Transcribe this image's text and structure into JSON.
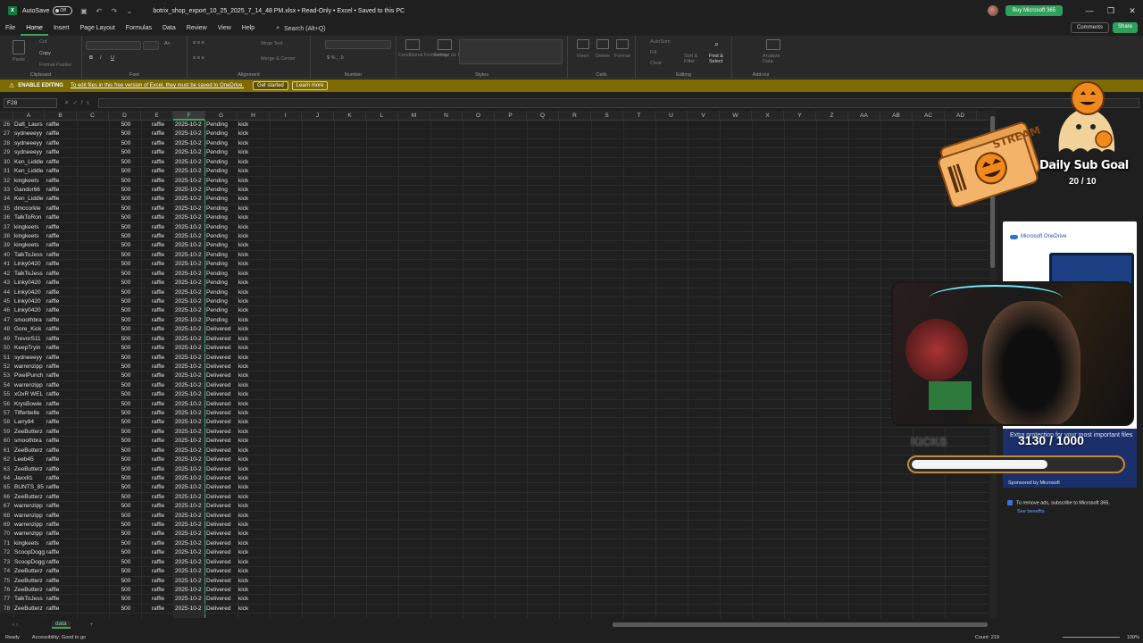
{
  "window": {
    "autosave_label": "AutoSave",
    "autosave_state": "Off",
    "file_title": "botrix_shop_export_10_25_2025_7_14_48 PM.xlsx  •  Read-Only  •  Excel  •  Saved to this PC",
    "buy_label": "Buy Microsoft 365"
  },
  "menu": {
    "tabs": [
      "File",
      "Home",
      "Insert",
      "Page Layout",
      "Formulas",
      "Data",
      "Review",
      "View",
      "Help"
    ],
    "active": "Home",
    "search": "Search (Alt+Q)",
    "comments": "Comments",
    "share": "Share"
  },
  "ribbon": {
    "groups": [
      "Clipboard",
      "Font",
      "Alignment",
      "Number",
      "Styles",
      "Cells",
      "Editing",
      "Add-ins"
    ],
    "paste": "Paste",
    "cut": "Cut",
    "copy": "Copy",
    "format_painter": "Format Painter",
    "wrap_text": "Wrap Text",
    "merge_center": "Merge & Center",
    "conditional": "Conditional Formatting",
    "format_table": "Format as Table",
    "insert": "Insert",
    "delete": "Delete",
    "format": "Format",
    "autosum": "AutoSum",
    "fill": "Fill",
    "clear": "Clear",
    "sort_filter": "Sort & Filter",
    "find_select": "Find & Select",
    "analyze": "Analyze Data"
  },
  "infobar": {
    "title": "ENABLE EDITING",
    "message": "To edit files in this free version of Excel, they must be saved to OneDrive.",
    "get_started": "Get started",
    "learn_more": "Learn more"
  },
  "formula": {
    "namebox": "F28",
    "content": ""
  },
  "grid": {
    "columns": [
      "A",
      "B",
      "C",
      "D",
      "E",
      "F",
      "G",
      "H",
      "I",
      "J",
      "K",
      "L",
      "M",
      "N",
      "O",
      "P",
      "Q",
      "R",
      "S",
      "T",
      "U",
      "V",
      "W",
      "X",
      "Y",
      "Z",
      "AA",
      "AB",
      "AC",
      "AD"
    ],
    "selected_column": "F",
    "rows": [
      [
        26,
        "Daft_Laurs",
        "raffle",
        "500",
        "raffle",
        "2025-10-2",
        "Pending",
        "kick"
      ],
      [
        27,
        "sydneeeyy",
        "raffle",
        "500",
        "raffle",
        "2025-10-2",
        "Pending",
        "kick"
      ],
      [
        28,
        "sydneeeyy",
        "raffle",
        "500",
        "raffle",
        "2025-10-2",
        "Pending",
        "kick"
      ],
      [
        29,
        "sydneeeyy",
        "raffle",
        "500",
        "raffle",
        "2025-10-2",
        "Pending",
        "kick"
      ],
      [
        30,
        "Ken_Liddle",
        "raffle",
        "500",
        "raffle",
        "2025-10-2",
        "Pending",
        "kick"
      ],
      [
        31,
        "Ken_Liddle",
        "raffle",
        "500",
        "raffle",
        "2025-10-2",
        "Pending",
        "kick"
      ],
      [
        32,
        "kingkeets",
        "raffle",
        "500",
        "raffle",
        "2025-10-2",
        "Pending",
        "kick"
      ],
      [
        33,
        "Gandor66",
        "raffle",
        "500",
        "raffle",
        "2025-10-2",
        "Pending",
        "kick"
      ],
      [
        34,
        "Ken_Liddle",
        "raffle",
        "500",
        "raffle",
        "2025-10-2",
        "Pending",
        "kick"
      ],
      [
        35,
        "dmccorkle",
        "raffle",
        "500",
        "raffle",
        "2025-10-2",
        "Pending",
        "kick"
      ],
      [
        36,
        "TalkToRon",
        "raffle",
        "500",
        "raffle",
        "2025-10-2",
        "Pending",
        "kick"
      ],
      [
        37,
        "kingkeets",
        "raffle",
        "500",
        "raffle",
        "2025-10-2",
        "Pending",
        "kick"
      ],
      [
        38,
        "kingkeets",
        "raffle",
        "500",
        "raffle",
        "2025-10-2",
        "Pending",
        "kick"
      ],
      [
        39,
        "kingkeets",
        "raffle",
        "500",
        "raffle",
        "2025-10-2",
        "Pending",
        "kick"
      ],
      [
        40,
        "TalkToJess",
        "raffle",
        "500",
        "raffle",
        "2025-10-2",
        "Pending",
        "kick"
      ],
      [
        41,
        "Linky0420",
        "raffle",
        "500",
        "raffle",
        "2025-10-2",
        "Pending",
        "kick"
      ],
      [
        42,
        "TalkToJess",
        "raffle",
        "500",
        "raffle",
        "2025-10-2",
        "Pending",
        "kick"
      ],
      [
        43,
        "Linky0420",
        "raffle",
        "500",
        "raffle",
        "2025-10-2",
        "Pending",
        "kick"
      ],
      [
        44,
        "Linky0420",
        "raffle",
        "500",
        "raffle",
        "2025-10-2",
        "Pending",
        "kick"
      ],
      [
        45,
        "Linky0420",
        "raffle",
        "500",
        "raffle",
        "2025-10-2",
        "Pending",
        "kick"
      ],
      [
        46,
        "Linky0420",
        "raffle",
        "500",
        "raffle",
        "2025-10-2",
        "Pending",
        "kick"
      ],
      [
        47,
        "smoothbra",
        "raffle",
        "500",
        "raffle",
        "2025-10-2",
        "Pending",
        "kick"
      ],
      [
        48,
        "Gore_Kick",
        "raffle",
        "500",
        "raffle",
        "2025-10-2",
        "Delivered",
        "kick"
      ],
      [
        49,
        "TrevorS11",
        "raffle",
        "500",
        "raffle",
        "2025-10-2",
        "Delivered",
        "kick"
      ],
      [
        50,
        "KeepTryin",
        "raffle",
        "500",
        "raffle",
        "2025-10-2",
        "Delivered",
        "kick"
      ],
      [
        51,
        "sydneeeyy",
        "raffle",
        "500",
        "raffle",
        "2025-10-2",
        "Delivered",
        "kick"
      ],
      [
        52,
        "warrenzipp",
        "raffle",
        "500",
        "raffle",
        "2025-10-2",
        "Delivered",
        "kick"
      ],
      [
        53,
        "PixelPunch",
        "raffle",
        "500",
        "raffle",
        "2025-10-2",
        "Delivered",
        "kick"
      ],
      [
        54,
        "warrenzipp",
        "raffle",
        "500",
        "raffle",
        "2025-10-2",
        "Delivered",
        "kick"
      ],
      [
        55,
        "xOxR WEL",
        "raffle",
        "500",
        "raffle",
        "2025-10-2",
        "Delivered",
        "kick"
      ],
      [
        56,
        "KrysBowie",
        "raffle",
        "500",
        "raffle",
        "2025-10-2",
        "Delivered",
        "kick"
      ],
      [
        57,
        "Tifferbelle",
        "raffle",
        "500",
        "raffle",
        "2025-10-2",
        "Delivered",
        "kick"
      ],
      [
        58,
        "Larry84",
        "raffle",
        "500",
        "raffle",
        "2025-10-2",
        "Delivered",
        "kick"
      ],
      [
        59,
        "ZeeButterz",
        "raffle",
        "500",
        "raffle",
        "2025-10-2",
        "Delivered",
        "kick"
      ],
      [
        60,
        "smoothbra",
        "raffle",
        "500",
        "raffle",
        "2025-10-2",
        "Delivered",
        "kick"
      ],
      [
        61,
        "ZeeButterz",
        "raffle",
        "500",
        "raffle",
        "2025-10-2",
        "Delivered",
        "kick"
      ],
      [
        62,
        "Leeb45",
        "raffle",
        "500",
        "raffle",
        "2025-10-2",
        "Delivered",
        "kick"
      ],
      [
        63,
        "ZeeButterz",
        "raffle",
        "500",
        "raffle",
        "2025-10-2",
        "Delivered",
        "kick"
      ],
      [
        64,
        "Jaxx81",
        "raffle",
        "500",
        "raffle",
        "2025-10-2",
        "Delivered",
        "kick"
      ],
      [
        65,
        "BUNTS_85",
        "raffle",
        "500",
        "raffle",
        "2025-10-2",
        "Delivered",
        "kick"
      ],
      [
        66,
        "ZeeButterz",
        "raffle",
        "500",
        "raffle",
        "2025-10-2",
        "Delivered",
        "kick"
      ],
      [
        67,
        "warrenzipp",
        "raffle",
        "500",
        "raffle",
        "2025-10-2",
        "Delivered",
        "kick"
      ],
      [
        68,
        "warrenzipp",
        "raffle",
        "500",
        "raffle",
        "2025-10-2",
        "Delivered",
        "kick"
      ],
      [
        69,
        "warrenzipp",
        "raffle",
        "500",
        "raffle",
        "2025-10-2",
        "Delivered",
        "kick"
      ],
      [
        70,
        "warrenzipp",
        "raffle",
        "500",
        "raffle",
        "2025-10-2",
        "Delivered",
        "kick"
      ],
      [
        71,
        "kingkeets",
        "raffle",
        "500",
        "raffle",
        "2025-10-2",
        "Delivered",
        "kick"
      ],
      [
        72,
        "ScoopDogg",
        "raffle",
        "500",
        "raffle",
        "2025-10-2",
        "Delivered",
        "kick"
      ],
      [
        73,
        "ScoopDogg",
        "raffle",
        "500",
        "raffle",
        "2025-10-2",
        "Delivered",
        "kick"
      ],
      [
        74,
        "ZeeButterz",
        "raffle",
        "500",
        "raffle",
        "2025-10-2",
        "Delivered",
        "kick"
      ],
      [
        75,
        "ZeeButterz",
        "raffle",
        "500",
        "raffle",
        "2025-10-2",
        "Delivered",
        "kick"
      ],
      [
        76,
        "ZeeButterz",
        "raffle",
        "500",
        "raffle",
        "2025-10-2",
        "Delivered",
        "kick"
      ],
      [
        77,
        "TalkToJess",
        "raffle",
        "500",
        "raffle",
        "2025-10-2",
        "Delivered",
        "kick"
      ],
      [
        78,
        "ZeeButterz",
        "raffle",
        "500",
        "raffle",
        "2025-10-2",
        "Delivered",
        "kick"
      ]
    ]
  },
  "sheet": {
    "tab": "data"
  },
  "status": {
    "ready": "Ready",
    "accessibility": "Accessibility: Good to go",
    "count": "Count: 219",
    "zoom": "100%"
  },
  "ad": {
    "brand": "Microsoft OneDrive",
    "text": "Extra protection for your most important files",
    "sponsored": "Sponsored by Microsoft",
    "remove": "To remove ads, subscribe to Microsoft 365.",
    "see_benefits": "See benefits"
  },
  "overlay": {
    "ticket_text": "STREAM",
    "subgoal_label": "Daily Sub Goal",
    "subgoal_value": "20 / 10",
    "kicks_label": "KICKS",
    "kicks_value": "3130 / 1000",
    "kicks_fraction": 0.65
  },
  "colors": {
    "excel_green": "#3ba55c",
    "infobar": "#7d6a00",
    "background": "#1f1f1f",
    "pumpkin": "#f08a1c"
  }
}
